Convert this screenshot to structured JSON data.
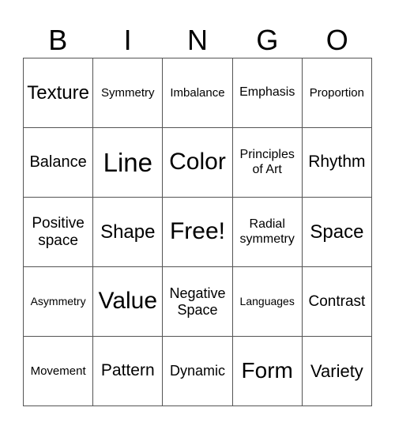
{
  "header": [
    "B",
    "I",
    "N",
    "G",
    "O"
  ],
  "rows": [
    [
      "Texture",
      "Symmetry",
      "Imbalance",
      "Emphasis",
      "Proportion"
    ],
    [
      "Balance",
      "Line",
      "Color",
      "Principles\nof Art",
      "Rhythm"
    ],
    [
      "Positive\nspace",
      "Shape",
      "Free!",
      "Radial\nsymmetry",
      "Space"
    ],
    [
      "Asymmetry",
      "Value",
      "Negative\nSpace",
      "Languages",
      "Contrast"
    ],
    [
      "Movement",
      "Pattern",
      "Dynamic",
      "Form",
      "Variety"
    ]
  ]
}
